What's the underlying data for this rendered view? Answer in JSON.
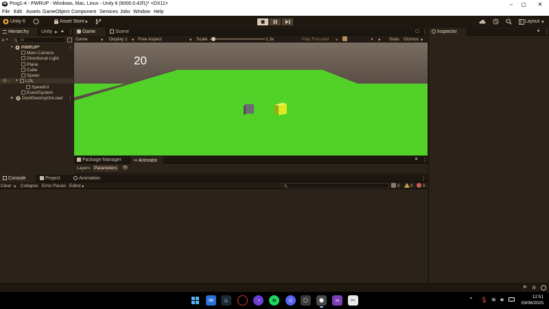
{
  "titlebar": {
    "title": "Prog1-4 - PWRUP - Windows, Mac, Linux - Unity 6 (6000.0.42f1)* <DX11>",
    "minimize": "–",
    "maximize": "▢",
    "close": "✕"
  },
  "menu": [
    "File",
    "Edit",
    "Assets",
    "GameObject",
    "Component",
    "Services",
    "Jobs",
    "Window",
    "Help"
  ],
  "toolbar": {
    "account": "Unity 6",
    "asset_store": "Asset Store",
    "layout": "Layout"
  },
  "hierarchy": {
    "tabs": [
      "Hierarchy",
      "Unity"
    ],
    "search_placeholder": "All",
    "scene": "PWRUP*",
    "items": [
      "Main Camera",
      "Directional Light",
      "Plane",
      "Cube",
      "Speler",
      "LOL",
      "SpeedUI",
      "EventSystem"
    ],
    "dont_destroy": "DontDestroyOnLoad"
  },
  "game": {
    "tabs": [
      "Game",
      "Scene"
    ],
    "view_mode": "Game",
    "display": "Display 1",
    "aspect": "Free Aspect",
    "scale_label": "Scale",
    "scale_value": "1.3x",
    "scale_level": 0.03,
    "play_focused": "Play Focused",
    "stats": "Stats",
    "gizmos": "Gizmos",
    "score": "20"
  },
  "animator": {
    "tabs": [
      "Package Manager",
      "Animator"
    ],
    "sub_tabs": [
      "Layers",
      "Parameters"
    ]
  },
  "console": {
    "tabs": [
      "Console",
      "Project",
      "Animation"
    ],
    "clear": "Clear",
    "collapse": "Collapse",
    "error_pause": "Error Pause",
    "editor": "Editor",
    "count_log": "0",
    "count_warn": "0",
    "count_err": "0"
  },
  "inspector": {
    "tab": "Inspector"
  },
  "taskbar": {
    "time": "12:51",
    "date": "03/06/2025"
  },
  "colors": {
    "ground": "#52d128",
    "sky": "#6e6157",
    "editor_bg": "#2b2219",
    "cube_yellow": "#dcea21",
    "cube_gray": "#6c6c74"
  }
}
